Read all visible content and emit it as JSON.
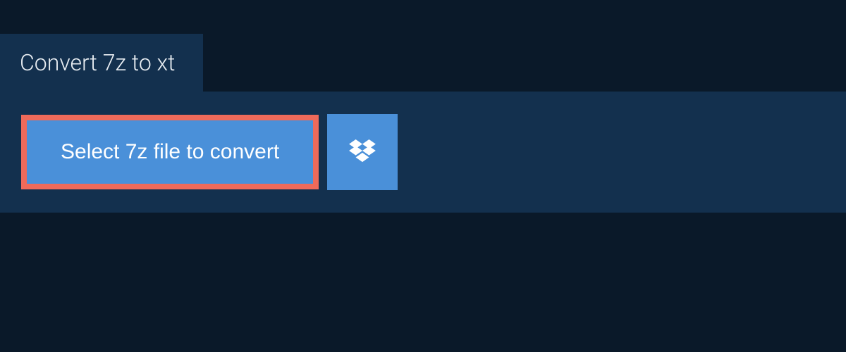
{
  "tab": {
    "title": "Convert 7z to xt"
  },
  "actions": {
    "select_file_label": "Select 7z file to convert"
  }
}
